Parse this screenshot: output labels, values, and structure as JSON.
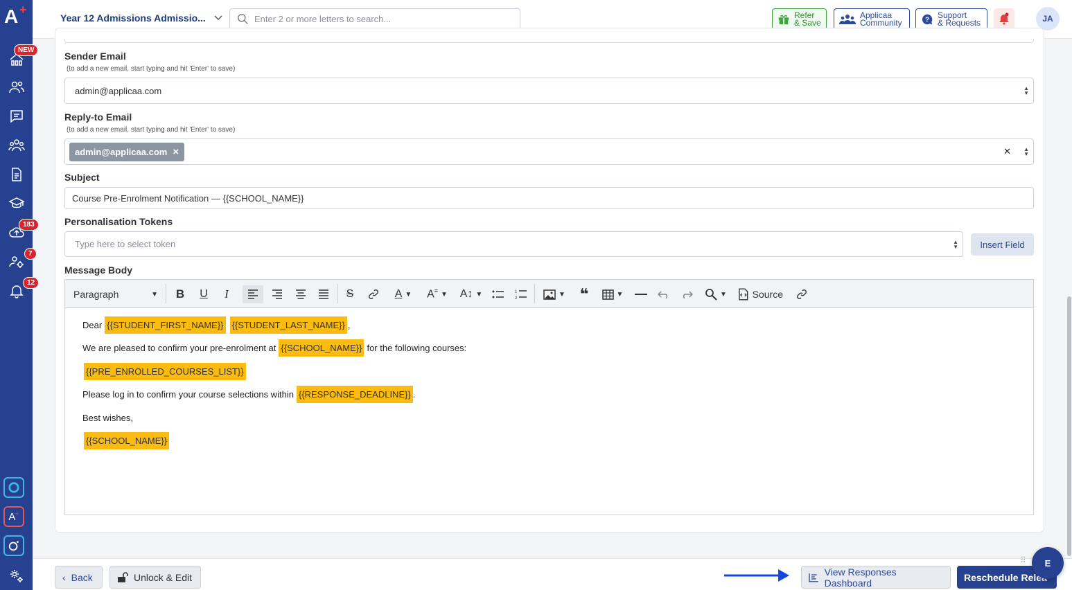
{
  "app": {
    "logo_text": "A"
  },
  "header": {
    "form_title": "Year 12 Admissions Admissio...",
    "search_placeholder": "Enter 2 or more letters to search...",
    "refer_line1": "Refer",
    "refer_line2": "& Save",
    "community_line1": "Applicaa",
    "community_line2": "Community",
    "support_line1": "Support",
    "support_line2": "& Requests",
    "avatar_initials": "JA"
  },
  "sidebar": {
    "new_badge": "NEW",
    "uploads_badge": "183",
    "staff_badge": "7",
    "notifications_badge": "12"
  },
  "form": {
    "sender_email_label": "Sender Email",
    "sender_email_hint": "(to add a new email, start typing and hit 'Enter' to save)",
    "sender_email_value": "admin@applicaa.com",
    "reply_to_label": "Reply-to Email",
    "reply_to_hint": "(to add a new email, start typing and hit 'Enter' to save)",
    "reply_to_tag": "admin@applicaa.com",
    "subject_label": "Subject",
    "subject_value": "Course Pre-Enrolment Notification — {{SCHOOL_NAME}}",
    "tokens_label": "Personalisation Tokens",
    "tokens_placeholder": "Type here to select token",
    "insert_field_label": "Insert Field",
    "message_body_label": "Message Body"
  },
  "editor": {
    "paragraph_format": "Paragraph",
    "source_label": "Source",
    "lines": {
      "greeting": "Dear",
      "token_first_name": "{{STUDENT_FIRST_NAME}}",
      "token_last_name": "{{STUDENT_LAST_NAME}}",
      "comma": ",",
      "confirm_text_1": "We are pleased to confirm your pre-enrolment at",
      "token_school_1": "{{SCHOOL_NAME}}",
      "confirm_text_2": "for the following courses:",
      "token_courses": "{{PRE_ENROLLED_COURSES_LIST}}",
      "login_text": "Please log in to confirm your course selections within",
      "token_deadline": "{{RESPONSE_DEADLINE}}",
      "period": ".",
      "closing": "Best wishes,",
      "token_school_2": "{{SCHOOL_NAME}}"
    }
  },
  "footer": {
    "back_label": "Back",
    "unlock_label": "Unlock & Edit",
    "dashboard_label": "View Responses Dashboard",
    "reschedule_label": "Reschedule Relea",
    "fab_label": "E"
  },
  "colors": {
    "brand": "#26418f",
    "token_highlight": "#fbbb10",
    "badge_red": "#d9232e",
    "arrow_blue": "#1546e0"
  }
}
